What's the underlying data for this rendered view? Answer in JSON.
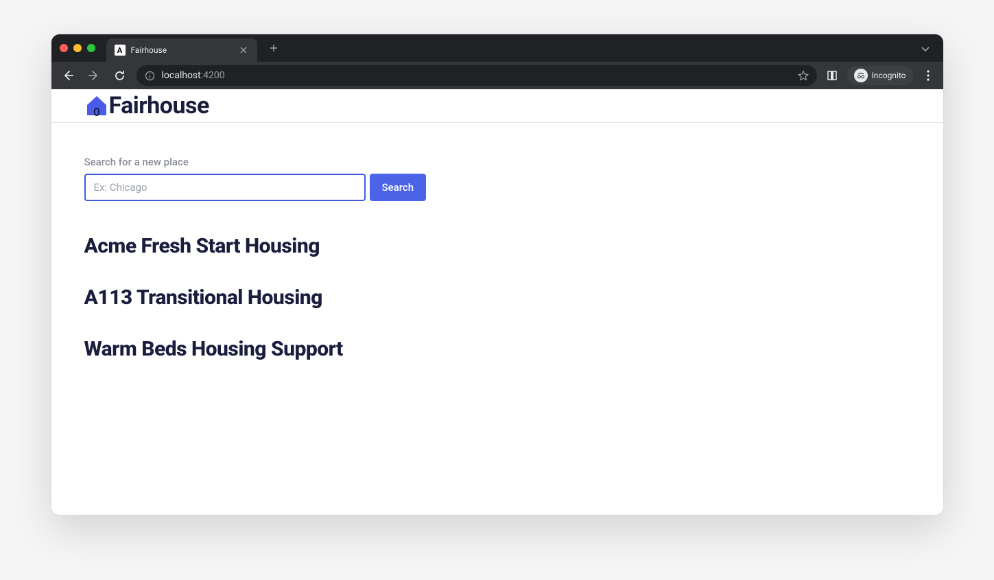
{
  "browser": {
    "tab_title": "Fairhouse",
    "tab_favicon_letter": "A",
    "url_host": "localhost",
    "url_port": ":4200",
    "incognito_label": "Incognito"
  },
  "app": {
    "brand": "Fairhouse"
  },
  "search": {
    "label": "Search for a new place",
    "placeholder": "Ex: Chicago",
    "button": "Search"
  },
  "listings": [
    {
      "title": "Acme Fresh Start Housing"
    },
    {
      "title": "A113 Transitional Housing"
    },
    {
      "title": "Warm Beds Housing Support"
    }
  ]
}
